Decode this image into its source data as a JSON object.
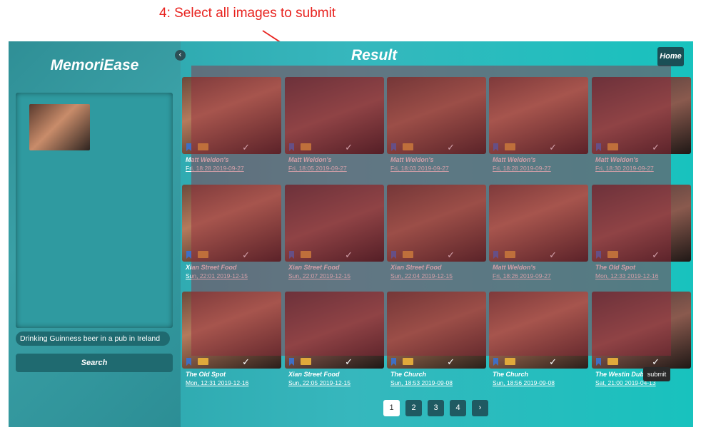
{
  "annotation": {
    "text": "4: Select all images to submit",
    "color": "#e8231f"
  },
  "sidebar": {
    "brand": "MemoriEase",
    "query_text": "Drinking Guinness beer in a pub in Ireland",
    "search_label": "Search",
    "collapse_icon": "chevron-left-icon"
  },
  "header": {
    "title": "Result",
    "home_label": "Home"
  },
  "results": [
    {
      "place": "Matt Weldon's",
      "date": "Fri, 18:28 2019-09-27"
    },
    {
      "place": "Matt Weldon's",
      "date": "Fri, 18:05 2019-09-27"
    },
    {
      "place": "Matt Weldon's",
      "date": "Fri, 18:03 2019-09-27"
    },
    {
      "place": "Matt Weldon's",
      "date": "Fri, 18:28 2019-09-27"
    },
    {
      "place": "Matt Weldon's",
      "date": "Fri, 18:30 2019-09-27"
    },
    {
      "place": "Xian Street Food",
      "date": "Sun, 22:01 2019-12-15"
    },
    {
      "place": "Xian Street Food",
      "date": "Sun, 22:07 2019-12-15"
    },
    {
      "place": "Xian Street Food",
      "date": "Sun, 22:04 2019-12-15"
    },
    {
      "place": "Matt Weldon's",
      "date": "Fri, 18:26 2019-09-27"
    },
    {
      "place": "The Old Spot",
      "date": "Mon, 12:33 2019-12-16"
    },
    {
      "place": "The Old Spot",
      "date": "Mon, 12:31 2019-12-16"
    },
    {
      "place": "Xian Street Food",
      "date": "Sun, 22:05 2019-12-15"
    },
    {
      "place": "The Church",
      "date": "Sun, 18:53 2019-09-08"
    },
    {
      "place": "The Church",
      "date": "Sun, 18:56 2019-09-08"
    },
    {
      "place": "The Westin Dub",
      "date": "Sat, 21:00 2019-04-13"
    }
  ],
  "card_icons": {
    "bookmark": "bookmark-icon",
    "folder": "folder-icon",
    "check": "check-icon"
  },
  "pagination": {
    "pages": [
      "1",
      "2",
      "3",
      "4"
    ],
    "next": "›",
    "active": "1"
  },
  "tooltip": "submit",
  "colors": {
    "accent": "#1f5a62",
    "brand_teal": "#2f9aa0",
    "selection_overlay": "#962846"
  }
}
